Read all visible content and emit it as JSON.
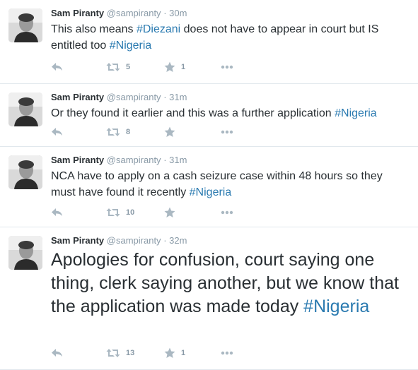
{
  "colors": {
    "hashtag": "#2a7ab0",
    "meta": "#8899a6",
    "text": "#292f33",
    "divider": "#e1e8ed"
  },
  "tweets": [
    {
      "fullname": "Sam Piranty",
      "handle": "@sampiranty",
      "separator": "·",
      "time": "30m",
      "text_plain": "This also means ",
      "hashtag1": "#Diezani",
      "text_plain2": " does not have to appear in court but IS entitled too ",
      "hashtag2": "#Nigeria",
      "retweets": "5",
      "favorites": "1"
    },
    {
      "fullname": "Sam Piranty",
      "handle": "@sampiranty",
      "separator": "·",
      "time": "31m",
      "text_plain": "Or they found it earlier and this was a further application ",
      "hashtag1": "#Nigeria",
      "retweets": "8",
      "favorites": ""
    },
    {
      "fullname": "Sam Piranty",
      "handle": "@sampiranty",
      "separator": "·",
      "time": "31m",
      "text_plain": "NCA have to apply on a cash seizure case within 48 hours so they must have found it recently ",
      "hashtag1": "#Nigeria",
      "retweets": "10",
      "favorites": ""
    },
    {
      "fullname": "Sam Piranty",
      "handle": "@sampiranty",
      "separator": "·",
      "time": "32m",
      "text_plain": "Apologies for confusion, court saying one thing, clerk saying another, but we know that the application was made today ",
      "hashtag1": "#Nigeria",
      "retweets": "13",
      "favorites": "1"
    }
  ],
  "icons": {
    "reply": "reply-icon",
    "retweet": "retweet-icon",
    "favorite": "star-icon",
    "more": "more-icon",
    "avatar": "profile-photo"
  }
}
